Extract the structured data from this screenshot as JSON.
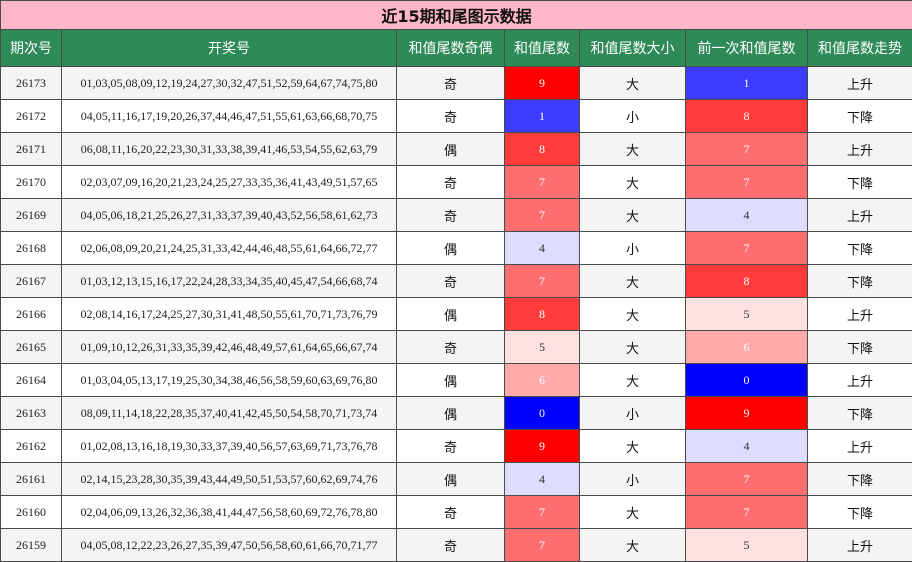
{
  "title": "近15期和尾图示数据",
  "headers": [
    "期次号",
    "开奖号",
    "和值尾数奇偶",
    "和值尾数",
    "和值尾数大小",
    "前一次和值尾数",
    "和值尾数走势"
  ],
  "heat_colors": {
    "0": "#0000ff",
    "1": "#3c3cff",
    "4": "#dcdcff",
    "5": "#ffe1e1",
    "6": "#ffaaaa",
    "7": "#ff6e6e",
    "8": "#ff3c3c",
    "9": "#ff0000"
  },
  "rows": [
    {
      "issue": "26173",
      "numbers": "01,03,05,08,09,12,19,24,27,30,32,47,51,52,59,64,67,74,75,80",
      "parity": "奇",
      "tail": "9",
      "size": "大",
      "prev_tail": "1",
      "trend": "上升"
    },
    {
      "issue": "26172",
      "numbers": "04,05,11,16,17,19,20,26,37,44,46,47,51,55,61,63,66,68,70,75",
      "parity": "奇",
      "tail": "1",
      "size": "小",
      "prev_tail": "8",
      "trend": "下降"
    },
    {
      "issue": "26171",
      "numbers": "06,08,11,16,20,22,23,30,31,33,38,39,41,46,53,54,55,62,63,79",
      "parity": "偶",
      "tail": "8",
      "size": "大",
      "prev_tail": "7",
      "trend": "上升"
    },
    {
      "issue": "26170",
      "numbers": "02,03,07,09,16,20,21,23,24,25,27,33,35,36,41,43,49,51,57,65",
      "parity": "奇",
      "tail": "7",
      "size": "大",
      "prev_tail": "7",
      "trend": "下降"
    },
    {
      "issue": "26169",
      "numbers": "04,05,06,18,21,25,26,27,31,33,37,39,40,43,52,56,58,61,62,73",
      "parity": "奇",
      "tail": "7",
      "size": "大",
      "prev_tail": "4",
      "trend": "上升"
    },
    {
      "issue": "26168",
      "numbers": "02,06,08,09,20,21,24,25,31,33,42,44,46,48,55,61,64,66,72,77",
      "parity": "偶",
      "tail": "4",
      "size": "小",
      "prev_tail": "7",
      "trend": "下降"
    },
    {
      "issue": "26167",
      "numbers": "01,03,12,13,15,16,17,22,24,28,33,34,35,40,45,47,54,66,68,74",
      "parity": "奇",
      "tail": "7",
      "size": "大",
      "prev_tail": "8",
      "trend": "下降"
    },
    {
      "issue": "26166",
      "numbers": "02,08,14,16,17,24,25,27,30,31,41,48,50,55,61,70,71,73,76,79",
      "parity": "偶",
      "tail": "8",
      "size": "大",
      "prev_tail": "5",
      "trend": "上升"
    },
    {
      "issue": "26165",
      "numbers": "01,09,10,12,26,31,33,35,39,42,46,48,49,57,61,64,65,66,67,74",
      "parity": "奇",
      "tail": "5",
      "size": "大",
      "prev_tail": "6",
      "trend": "下降"
    },
    {
      "issue": "26164",
      "numbers": "01,03,04,05,13,17,19,25,30,34,38,46,56,58,59,60,63,69,76,80",
      "parity": "偶",
      "tail": "6",
      "size": "大",
      "prev_tail": "0",
      "trend": "上升"
    },
    {
      "issue": "26163",
      "numbers": "08,09,11,14,18,22,28,35,37,40,41,42,45,50,54,58,70,71,73,74",
      "parity": "偶",
      "tail": "0",
      "size": "小",
      "prev_tail": "9",
      "trend": "下降"
    },
    {
      "issue": "26162",
      "numbers": "01,02,08,13,16,18,19,30,33,37,39,40,56,57,63,69,71,73,76,78",
      "parity": "奇",
      "tail": "9",
      "size": "大",
      "prev_tail": "4",
      "trend": "上升"
    },
    {
      "issue": "26161",
      "numbers": "02,14,15,23,28,30,35,39,43,44,49,50,51,53,57,60,62,69,74,76",
      "parity": "偶",
      "tail": "4",
      "size": "小",
      "prev_tail": "7",
      "trend": "下降"
    },
    {
      "issue": "26160",
      "numbers": "02,04,06,09,13,26,32,36,38,41,44,47,56,58,60,69,72,76,78,80",
      "parity": "奇",
      "tail": "7",
      "size": "大",
      "prev_tail": "7",
      "trend": "下降"
    },
    {
      "issue": "26159",
      "numbers": "04,05,08,12,22,23,26,27,35,39,47,50,56,58,60,61,66,70,71,77",
      "parity": "奇",
      "tail": "7",
      "size": "大",
      "prev_tail": "5",
      "trend": "上升"
    }
  ]
}
